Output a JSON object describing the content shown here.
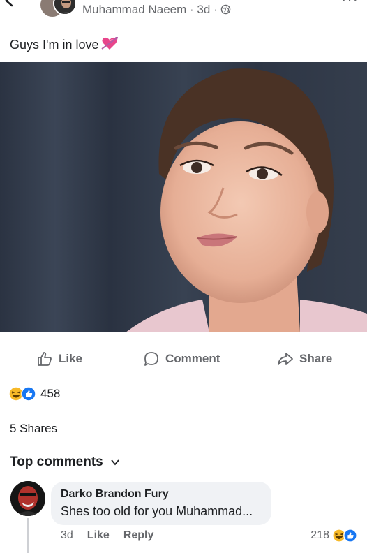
{
  "post": {
    "author": "Muhammad Naeem",
    "timestamp": "3d",
    "separator": "·",
    "caption": "Guys I'm in love",
    "caption_emoji": "heart-with-arrow-icon"
  },
  "actions": {
    "like_label": "Like",
    "comment_label": "Comment",
    "share_label": "Share"
  },
  "reactions": {
    "icons": [
      "haha-icon",
      "like-icon"
    ],
    "count": "458"
  },
  "shares_label": "5 Shares",
  "top_comments_label": "Top comments",
  "comment": {
    "author": "Darko Brandon Fury",
    "text": "Shes too old for you Muhammad...",
    "timestamp": "3d",
    "like_label": "Like",
    "reply_label": "Reply",
    "reaction_count": "218",
    "reaction_icons": [
      "haha-icon",
      "like-icon"
    ]
  },
  "colors": {
    "secondary_text": "#65676b",
    "primary_text": "#1c1e21",
    "bubble": "#f0f2f5",
    "like_blue": "#1877f2",
    "haha_yellow": "#f7b928"
  }
}
